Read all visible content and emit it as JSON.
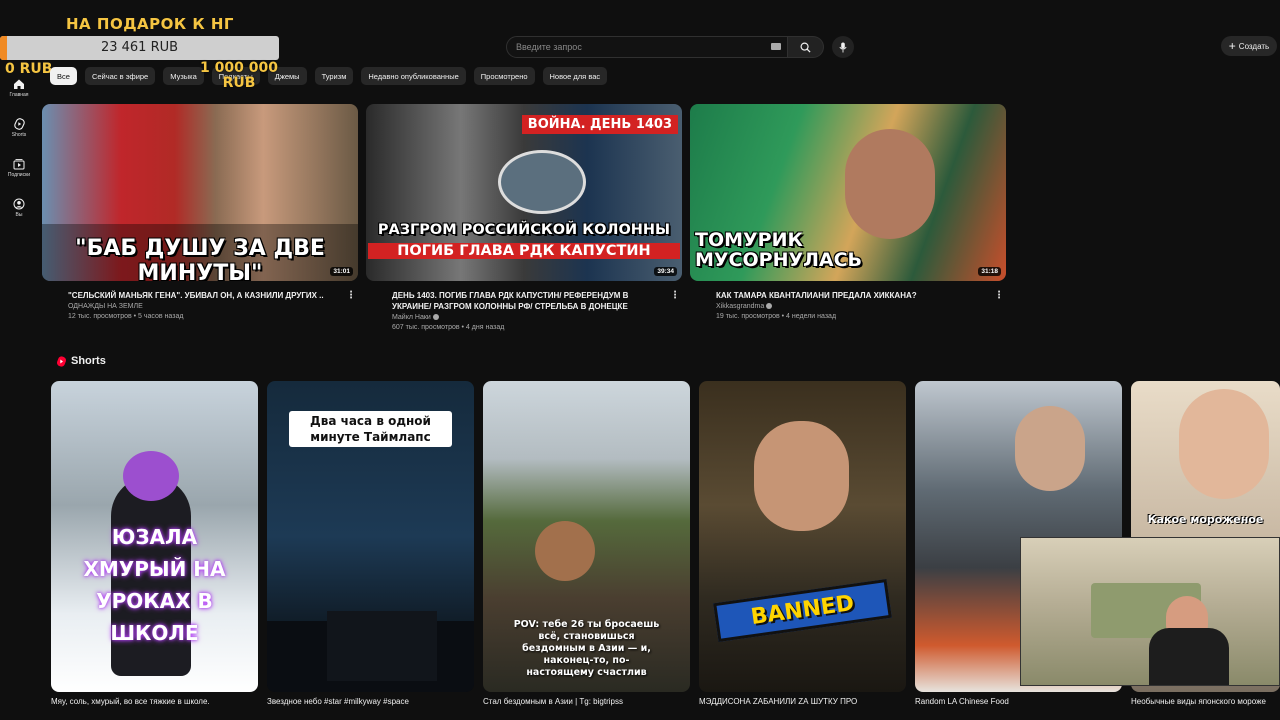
{
  "overlay": {
    "goal_title": "НА ПОДАРОК К НГ",
    "current_amount": "23 461 RUB",
    "min_label": "0 RUB",
    "max_label": "1 000 000 RUB",
    "progress_fraction": 0.023461
  },
  "header": {
    "search_placeholder": "Введите запрос",
    "create_label": "Создать"
  },
  "sidebar": {
    "items": [
      {
        "label": "Главная",
        "icon": "home-icon"
      },
      {
        "label": "Shorts",
        "icon": "shorts-icon"
      },
      {
        "label": "Подписки",
        "icon": "subscriptions-icon"
      },
      {
        "label": "Вы",
        "icon": "you-icon"
      }
    ]
  },
  "chips": [
    "Все",
    "Сейчас в эфире",
    "Музыка",
    "Подкасты",
    "Джемы",
    "Туризм",
    "Недавно опубликованные",
    "Просмотрено",
    "Новое для вас"
  ],
  "videos": [
    {
      "title": "\"СЕЛЬСКИЙ МАНЬЯК ГЕНА\". УБИВАЛ ОН, А КАЗНИЛИ ДРУГИХ ..",
      "channel": "ОДНАЖДЫ НА ЗЕМЛЕ",
      "stats": "12 тыс. просмотров • 5 часов назад",
      "duration": "31:01",
      "thumb_caption": "\"БАБ ДУШУ ЗА ДВЕ МИНУТЫ\""
    },
    {
      "title": "ДЕНЬ 1403. ПОГИБ ГЛАВА РДК КАПУСТИН/ РЕФЕРЕНДУМ В УКРАИНЕ/ РАЗГРОМ КОЛОННЫ РФ/ СТРЕЛЬБА В ДОНЕЦКЕ",
      "channel": "Майкл Наки",
      "stats": "607 тыс. просмотров • 4 дня назад",
      "duration": "39:34",
      "thumb_badge": "ВОЙНА. ДЕНЬ 1403",
      "thumb_caption_1": "РАЗГРОМ РОССИЙСКОЙ КОЛОННЫ",
      "thumb_caption_2": "ПОГИБ ГЛАВА РДК КАПУСТИН"
    },
    {
      "title": "КАК ТАМАРА КВАНТАЛИАНИ ПРЕДАЛА ХИККАНА?",
      "channel": "Xikkasgrandma",
      "stats": "19 тыс. просмотров • 4 недели назад",
      "duration": "31:18",
      "thumb_caption_1": "ТОМУРИК",
      "thumb_caption_2": "МУСОРНУЛАСЬ"
    }
  ],
  "shorts": {
    "section_title": "Shorts",
    "items": [
      {
        "title": "Мяу, соль, хмурый, во все тяжкие в школе.",
        "overlay": "ЮЗАЛА ХМУРЫЙ НА УРОКАХ В ШКОЛЕ"
      },
      {
        "title": "Звездное небо #star #milkyway #space",
        "overlay": "Два часа в одной минуте Таймлапс"
      },
      {
        "title": "Стал бездомным в Азии | Tg: bigtripss",
        "overlay": "POV: тебе 26 ты бросаешь всё, становишься бездомным в Азии — и, наконец-то, по-настоящему счастлив"
      },
      {
        "title": "МЭДДИСОНА ZАБАНИЛИ ZА ШУТКУ ПРО",
        "overlay": "BANNED"
      },
      {
        "title": "Random LA Chinese Food",
        "overlay": ""
      },
      {
        "title": "Необычные виды японского мороже",
        "overlay": "Какое мороженое"
      }
    ]
  }
}
